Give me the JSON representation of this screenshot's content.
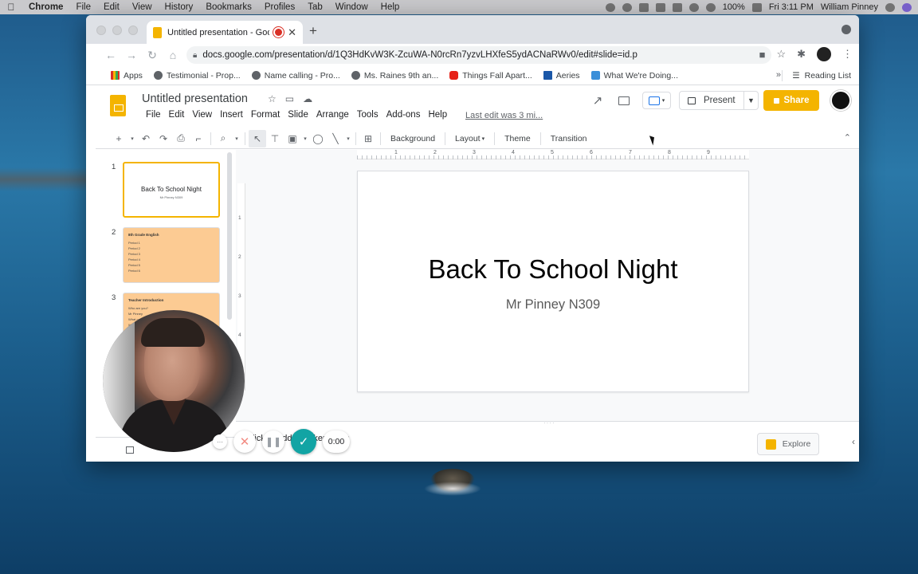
{
  "menubar": {
    "app": "Chrome",
    "items": [
      "File",
      "Edit",
      "View",
      "History",
      "Bookmarks",
      "Profiles",
      "Tab",
      "Window",
      "Help"
    ],
    "battery": "100%",
    "clock": "Fri 3:11 PM",
    "user": "William Pinney"
  },
  "browser": {
    "tab_title": "Untitled presentation - Goo",
    "url": "docs.google.com/presentation/d/1Q3HdKvW3K-ZcuWA-N0rcRn7yzvLHXfeS5ydACNaRWv0/edit#slide=id.p",
    "bookmarks": [
      "Apps",
      "Testimonial - Prop...",
      "Name calling - Pro...",
      "Ms. Raines 9th an...",
      "Things Fall Apart...",
      "Aeries",
      "What We're Doing..."
    ],
    "reading_list": "Reading List"
  },
  "slides_app": {
    "doc_title": "Untitled presentation",
    "menus": [
      "File",
      "Edit",
      "View",
      "Insert",
      "Format",
      "Slide",
      "Arrange",
      "Tools",
      "Add-ons",
      "Help"
    ],
    "last_edit": "Last edit was 3 mi...",
    "present_label": "Present",
    "share_label": "Share",
    "toolbar": {
      "background": "Background",
      "layout": "Layout",
      "theme": "Theme",
      "transition": "Transition"
    }
  },
  "filmstrip": [
    {
      "number": "1",
      "title": "Back To School Night",
      "subtitle": "Mr Pinney N309"
    },
    {
      "number": "2",
      "title": "8th Grade English",
      "lines": [
        "Period 1",
        "Period 2",
        "Period 3",
        "Period 4",
        "Period 5",
        "Period 6"
      ]
    },
    {
      "number": "3",
      "title": "Teacher Introduction",
      "lines": [
        "Who are you?",
        "Mr Pinney",
        "What can I teach...",
        "Why I ..."
      ]
    }
  ],
  "ruler": {
    "h_ticks": [
      "1",
      "2",
      "3",
      "4",
      "5",
      "6",
      "7",
      "8",
      "9"
    ],
    "v_ticks": [
      "1",
      "2",
      "3",
      "4"
    ]
  },
  "slide": {
    "title": "Back To School Night",
    "subtitle": "Mr Pinney N309"
  },
  "notes": {
    "placeholder": "Click to add speaker notes",
    "explore_label": "Explore"
  },
  "recorder": {
    "timer": "0:00"
  },
  "colors": {
    "slides_yellow": "#f4b400",
    "thumb_orange": "#fccb93",
    "record_teal": "#12a4a4"
  }
}
